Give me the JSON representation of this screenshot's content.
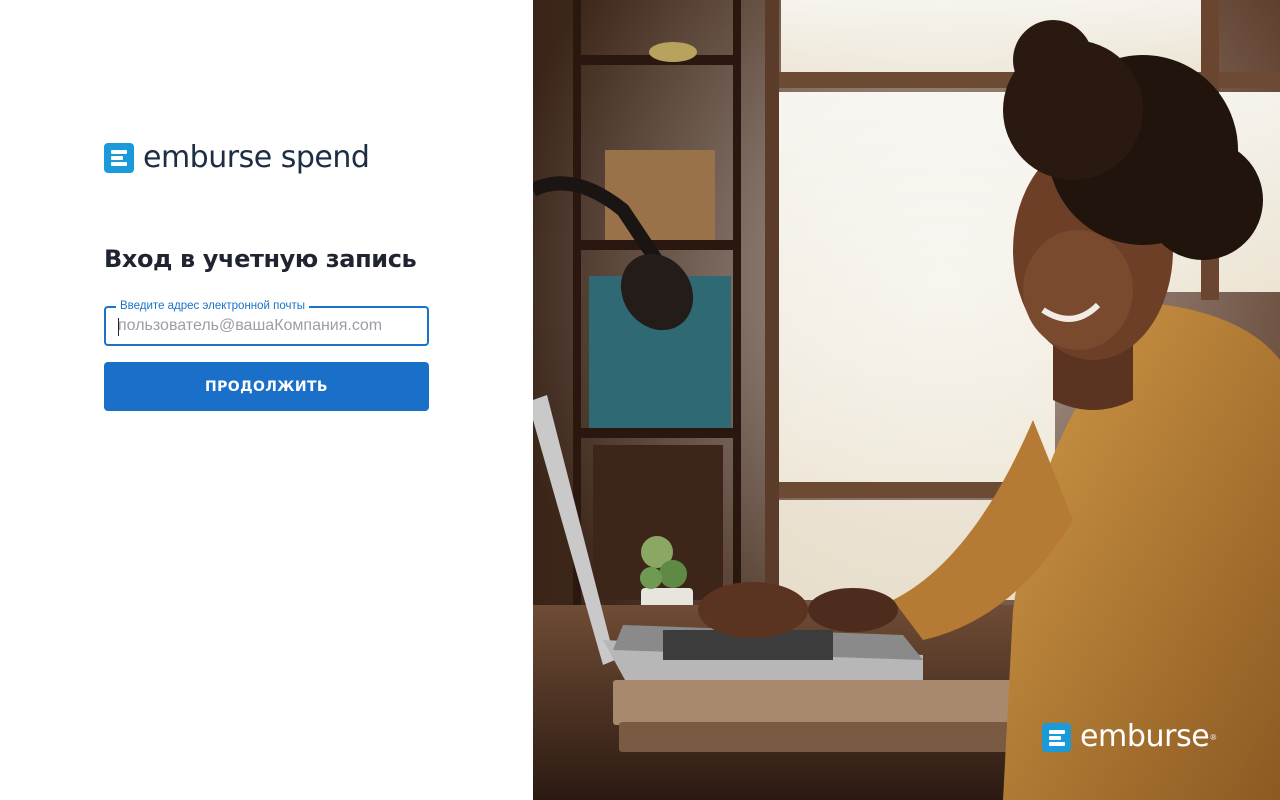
{
  "logo": {
    "text": "emburse spend",
    "icon": "emburse-e-icon",
    "color": "#1a9ad9"
  },
  "login": {
    "title": "Вход в учетную запись",
    "email_label": "Введите адрес электронной почты",
    "email_placeholder": "пользователь@вашаКомпания.com",
    "email_value": "",
    "continue_label": "ПРОДОЛЖИТЬ"
  },
  "hero": {
    "image_icon": "woman-with-laptop-photo",
    "brand_text": "emburse",
    "brand_registered": "®"
  },
  "colors": {
    "accent": "#1a6fc9",
    "brand": "#1a9ad9",
    "text": "#1f2430"
  }
}
